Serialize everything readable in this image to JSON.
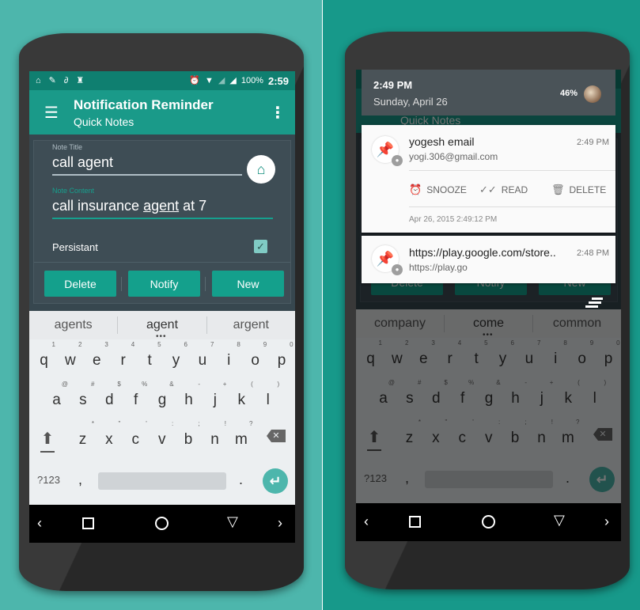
{
  "left_phone": {
    "status_bar": {
      "notification_icons": [
        "home-icon",
        "pin-icon",
        "paperclip-icon",
        "android-icon"
      ],
      "battery": "100%",
      "time": "2:59"
    },
    "app_bar": {
      "title": "Notification Reminder",
      "subtitle": "Quick Notes"
    },
    "form": {
      "note_title_label": "Note Title",
      "note_title_value": "call agent",
      "note_content_label": "Note Content",
      "note_content_before": "call insurance ",
      "note_content_underlined": "agent",
      "note_content_after": " at 7",
      "persistent_label": "Persistant",
      "persistent_checked": true,
      "buttons": {
        "delete": "Delete",
        "notify": "Notify",
        "new": "New"
      }
    },
    "keyboard": {
      "suggestions": [
        "agents",
        "agent",
        "argent"
      ],
      "row1": [
        {
          "ch": "q",
          "hint": "1"
        },
        {
          "ch": "w",
          "hint": "2"
        },
        {
          "ch": "e",
          "hint": "3"
        },
        {
          "ch": "r",
          "hint": "4"
        },
        {
          "ch": "t",
          "hint": "5"
        },
        {
          "ch": "y",
          "hint": "6"
        },
        {
          "ch": "u",
          "hint": "7"
        },
        {
          "ch": "i",
          "hint": "8"
        },
        {
          "ch": "o",
          "hint": "9"
        },
        {
          "ch": "p",
          "hint": "0"
        }
      ],
      "row2": [
        {
          "ch": "a",
          "hint": "@"
        },
        {
          "ch": "s",
          "hint": "#"
        },
        {
          "ch": "d",
          "hint": "$"
        },
        {
          "ch": "f",
          "hint": "%"
        },
        {
          "ch": "g",
          "hint": "&"
        },
        {
          "ch": "h",
          "hint": "-"
        },
        {
          "ch": "j",
          "hint": "+"
        },
        {
          "ch": "k",
          "hint": "("
        },
        {
          "ch": "l",
          "hint": ")"
        }
      ],
      "row3": [
        {
          "ch": "z",
          "hint": "*"
        },
        {
          "ch": "x",
          "hint": "\""
        },
        {
          "ch": "c",
          "hint": "'"
        },
        {
          "ch": "v",
          "hint": ":"
        },
        {
          "ch": "b",
          "hint": ";"
        },
        {
          "ch": "n",
          "hint": "!"
        },
        {
          "ch": "m",
          "hint": "?"
        }
      ],
      "symbols_key": "?123",
      "comma": ",",
      "period": "."
    },
    "nav": {
      "back": "‹",
      "forward": "›"
    }
  },
  "right_phone": {
    "shade": {
      "time": "2:49 PM",
      "date": "Sunday, April 26",
      "battery": "46%"
    },
    "notifications": [
      {
        "title": "yogesh email",
        "text": "yogi.306@gmail.com",
        "time": "2:49 PM",
        "actions": [
          "SNOOZE",
          "READ",
          "DELETE"
        ],
        "timestamp": "Apr 26, 2015 2:49:12 PM"
      },
      {
        "title": "https://play.google.com/store..",
        "text": "https://play.go",
        "time": "2:48 PM"
      }
    ],
    "background_app": {
      "subtitle": "Quick Notes",
      "buttons": [
        "Delete",
        "Notify",
        "New"
      ]
    },
    "keyboard": {
      "suggestions": [
        "company",
        "come",
        "common"
      ]
    },
    "nav": {
      "back": "‹",
      "forward": "›"
    }
  },
  "colors": {
    "accent": "#1a9a89",
    "status_bar": "#0f7f70",
    "background_left": "#4db6ac",
    "background_right": "#17998a"
  }
}
